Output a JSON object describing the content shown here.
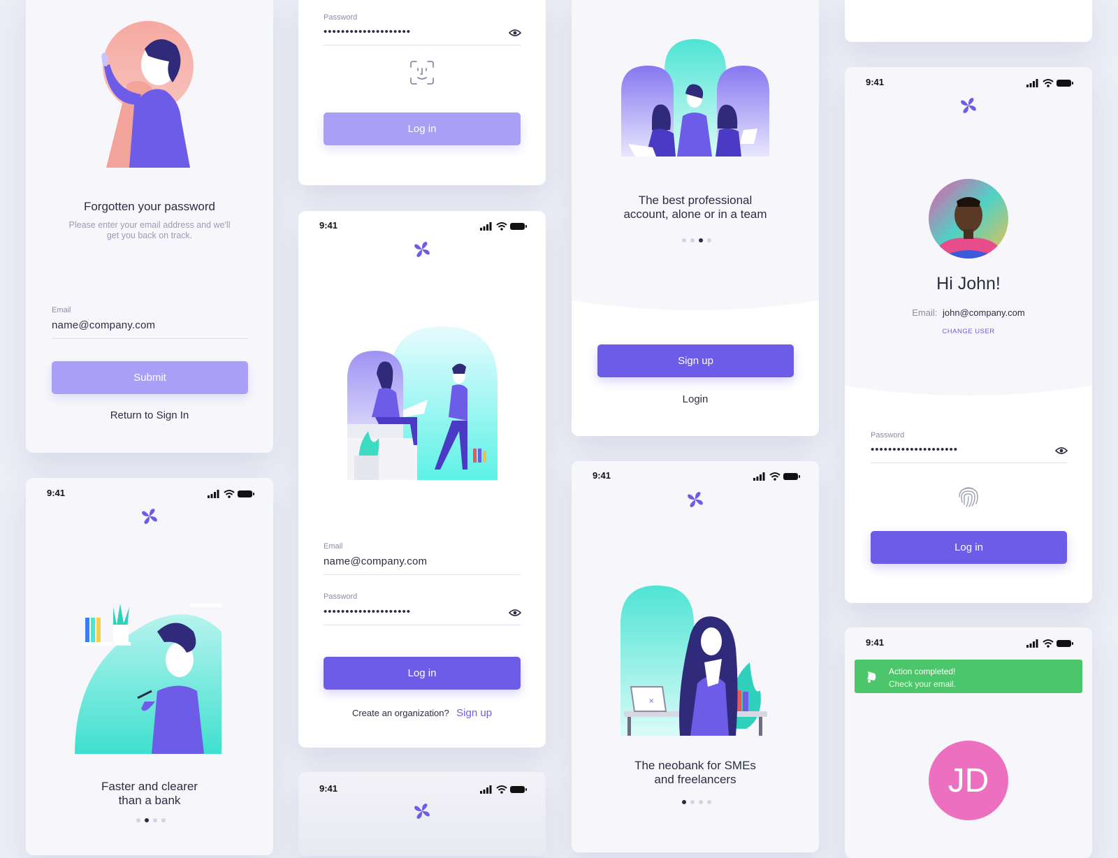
{
  "status": {
    "time": "9:41"
  },
  "forgot": {
    "title": "Forgotten your password",
    "subtitle_line1": "Please enter your email address and we'll",
    "subtitle_line2": "get you back on track.",
    "email_label": "Email",
    "email_value": "name@company.com",
    "submit_label": "Submit",
    "return_link": "Return to Sign In"
  },
  "face_login": {
    "password_label": "Password",
    "password_value": "••••••••••••••••••••",
    "login_label": "Log in"
  },
  "login": {
    "email_label": "Email",
    "email_value": "name@company.com",
    "password_label": "Password",
    "password_value": "••••••••••••••••••••",
    "login_label": "Log in",
    "create_org_text": "Create an organization?",
    "signup_link": "Sign up"
  },
  "onboard_team": {
    "title_line1": "The best professional",
    "title_line2": "account, alone or in a team",
    "signup_label": "Sign up",
    "login_label": "Login"
  },
  "onboard_fast": {
    "title_line1": "Faster and clearer",
    "title_line2": "than a bank"
  },
  "onboard_neobank": {
    "title_line1": "The neobank for SMEs",
    "title_line2": "and freelancers"
  },
  "welcome_back": {
    "greeting": "Hi John!",
    "email_label": "Email:",
    "email_value": "john@company.com",
    "change_user": "CHANGE USER",
    "password_label": "Password",
    "password_value": "••••••••••••••••••••",
    "login_label": "Log in"
  },
  "toast_screen": {
    "toast_title": "Action completed!",
    "toast_message": "Check your email.",
    "avatar_initials": "JD"
  },
  "colors": {
    "accent": "#6c5ce7",
    "accent_light": "#a99ff7",
    "teal": "#5ee6d8",
    "success": "#4cc66b",
    "avatar_pink": "#ec6fc0"
  },
  "icons": [
    "logo-icon",
    "eye-icon",
    "face-id-icon",
    "fingerprint-icon",
    "bell-icon",
    "signal-icon",
    "wifi-icon",
    "battery-icon"
  ]
}
